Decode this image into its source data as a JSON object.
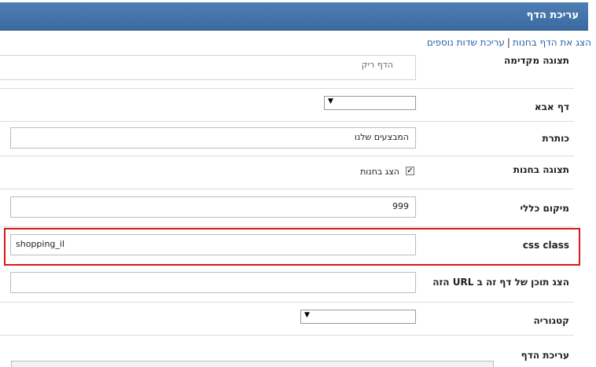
{
  "header": {
    "title": "עריכת הדף"
  },
  "links": {
    "show_in_store": "הצג את הדף בחנות",
    "separator": "|",
    "edit_extra_fields": "עריכת שדות נוספים"
  },
  "fields": {
    "preview": {
      "label": "תצוגה מקדימה",
      "value": "הדף ריק"
    },
    "parent_page": {
      "label": "דף אבא",
      "selected": ""
    },
    "title": {
      "label": "כותרת",
      "value": "המבצעים שלנו"
    },
    "store_display": {
      "label": "תצוגה בחנות",
      "checkbox_label": "הצג בחנות",
      "checked": true
    },
    "general_position": {
      "label": "מיקום כללי",
      "value": "999"
    },
    "css_class": {
      "label": "css class",
      "value": "shopping_il"
    },
    "url_content": {
      "label": "הצג תוכן של דף זה ב URL הזה",
      "value": ""
    },
    "category": {
      "label": "קטגוריה",
      "selected": ""
    },
    "page_edit": {
      "label": "עריכת הדף"
    }
  },
  "icons": {
    "dropdown": "triangle-down-icon",
    "check": "checkmark-icon"
  },
  "colors": {
    "header_bg": "#3d6ea5",
    "link": "#2a64a8",
    "highlight": "#d9181c"
  }
}
